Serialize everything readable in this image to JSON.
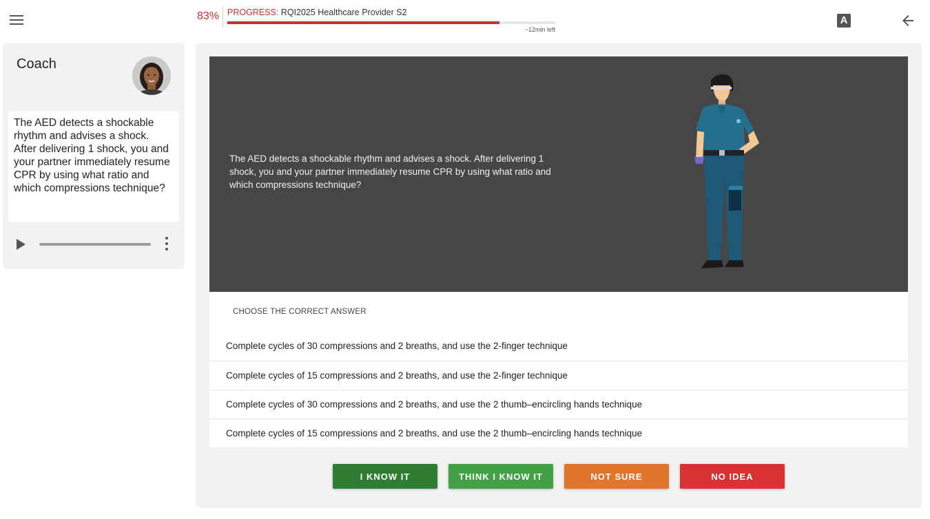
{
  "header": {
    "progress_percent_label": "83%",
    "progress_key": "PROGRESS:",
    "progress_course": " RQI2025 Healthcare Provider S2",
    "progress_fraction": 0.83,
    "time_left": "~12min left",
    "font_toggle_letter": "A",
    "icons": {
      "menu": "hamburger-menu-icon",
      "font": "font-size-icon",
      "back": "arrow-left-icon"
    }
  },
  "coach": {
    "title": "Coach",
    "message": "The AED detects a shockable rhythm and advises a shock. After delivering 1 shock, you and your partner immediately resume CPR by using what ratio and which compressions technique?",
    "audio_progress": 0.0,
    "icons": {
      "play": "play-icon",
      "more": "more-vertical-icon"
    }
  },
  "question": {
    "text": "The AED detects a shockable rhythm and advises a shock. After delivering 1 shock, you and your partner immediately resume CPR by using what ratio and which compressions technique?",
    "instruction": "CHOOSE THE CORRECT ANSWER",
    "options": [
      "Complete cycles of 30 compressions and 2 breaths, and use the 2-finger technique",
      "Complete cycles of 15 compressions and 2 breaths, and use the 2-finger technique",
      "Complete cycles of 30 compressions and 2 breaths, and use the 2 thumb–encircling hands technique",
      "Complete cycles of 15 compressions and 2 breaths, and use the 2 thumb–encircling hands technique"
    ]
  },
  "confidence_buttons": [
    {
      "label": "I KNOW IT",
      "color": "#2e7d32"
    },
    {
      "label": "THINK I KNOW IT",
      "color": "#43a047"
    },
    {
      "label": "NOT SURE",
      "color": "#e0752d"
    },
    {
      "label": "NO IDEA",
      "color": "#d83232"
    }
  ],
  "colors": {
    "accent_red": "#c8312f",
    "panel_bg": "#f2f2f2",
    "scene_bg": "#464646"
  }
}
